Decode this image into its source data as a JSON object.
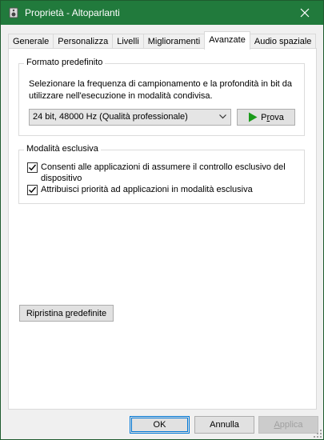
{
  "window": {
    "title": "Proprietà - Altoparlanti",
    "app_icon": "speaker-icon",
    "close_icon": "close-icon",
    "titlebar_color": "#217a3c"
  },
  "tabs": [
    {
      "label": "Generale",
      "active": false
    },
    {
      "label": "Personalizza",
      "active": false
    },
    {
      "label": "Livelli",
      "active": false
    },
    {
      "label": "Miglioramenti",
      "active": false
    },
    {
      "label": "Avanzate",
      "active": true
    },
    {
      "label": "Audio spaziale",
      "active": false
    }
  ],
  "default_format": {
    "group_title": "Formato predefinito",
    "description": "Selezionare la frequenza di campionamento e la profondità in bit da utilizzare nell'esecuzione in modalità condivisa.",
    "selected_format": "24 bit, 48000 Hz (Qualità professionale)",
    "test_button": {
      "prefix": "P",
      "accel": "r",
      "suffix": "ova",
      "icon": "play-icon",
      "icon_color": "#1a9b1a"
    }
  },
  "exclusive_mode": {
    "group_title": "Modalità esclusiva",
    "options": [
      {
        "label": "Consenti alle applicazioni di assumere il controllo esclusivo del dispositivo",
        "checked": true
      },
      {
        "label": "Attribuisci priorità ad applicazioni in modalità esclusiva",
        "checked": true
      }
    ]
  },
  "restore_button": {
    "prefix": "Ripristina ",
    "accel": "p",
    "suffix": "redefinite"
  },
  "footer": {
    "ok": "OK",
    "cancel": "Annulla",
    "apply": {
      "prefix": "",
      "accel": "A",
      "suffix": "pplica",
      "enabled": false
    }
  }
}
